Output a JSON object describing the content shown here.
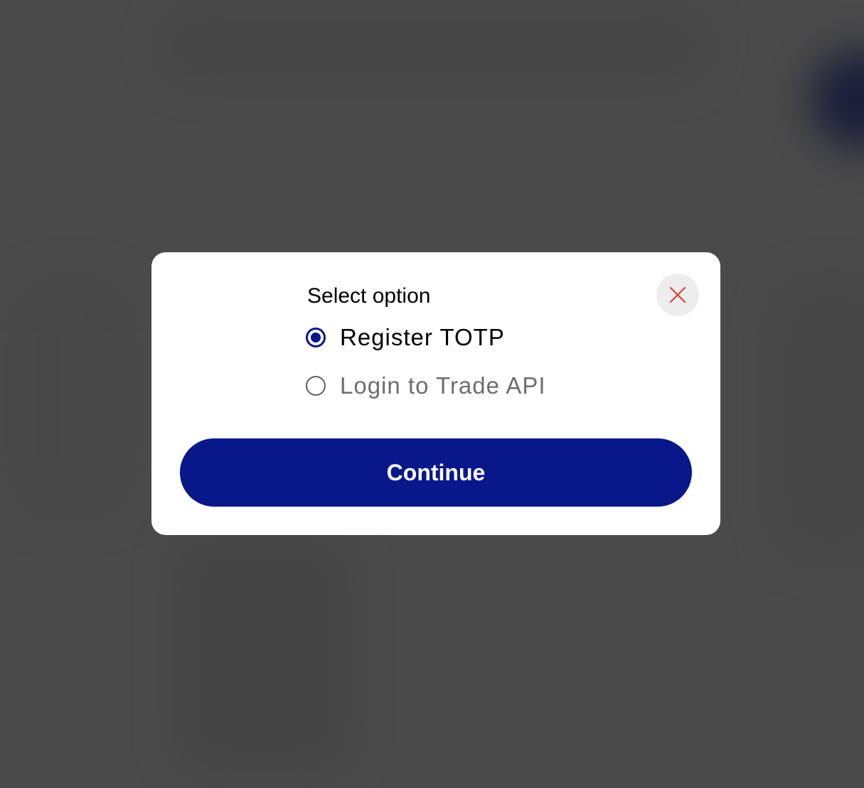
{
  "dialog": {
    "title": "Select option",
    "close_icon": "close-icon",
    "options": [
      {
        "label": "Register TOTP",
        "selected": true
      },
      {
        "label": "Login to Trade API",
        "selected": false
      }
    ],
    "continue_label": "Continue"
  },
  "colors": {
    "accent": "#08188a",
    "close_icon": "#d9423a",
    "overlay": "#4a4a4a",
    "close_button_bg": "#ededed"
  }
}
